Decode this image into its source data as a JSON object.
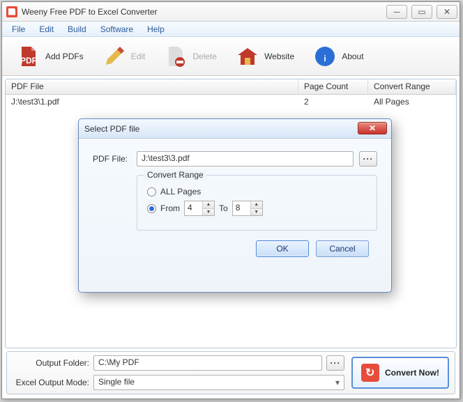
{
  "app": {
    "title": "Weeny Free PDF to Excel Converter"
  },
  "menu": {
    "file": "File",
    "edit": "Edit",
    "build": "Build",
    "software": "Software",
    "help": "Help"
  },
  "toolbar": {
    "add": "Add PDFs",
    "edit": "Edit",
    "delete": "Delete",
    "website": "Website",
    "about": "About"
  },
  "table": {
    "headers": {
      "file": "PDF File",
      "pages": "Page Count",
      "range": "Convert Range"
    },
    "rows": [
      {
        "file": "J:\\test3\\1.pdf",
        "pages": "2",
        "range": "All Pages"
      }
    ]
  },
  "bottom": {
    "output_label": "Output Folder:",
    "output_value": "C:\\My PDF",
    "mode_label": "Excel Output Mode:",
    "mode_value": "Single file",
    "convert": "Convert Now!"
  },
  "dialog": {
    "title": "Select PDF file",
    "file_label": "PDF File:",
    "file_value": "J:\\test3\\3.pdf",
    "range_legend": "Convert Range",
    "all_label": "ALL Pages",
    "from_label": "From",
    "to_label": "To",
    "from_value": "4",
    "to_value": "8",
    "ok": "OK",
    "cancel": "Cancel"
  }
}
